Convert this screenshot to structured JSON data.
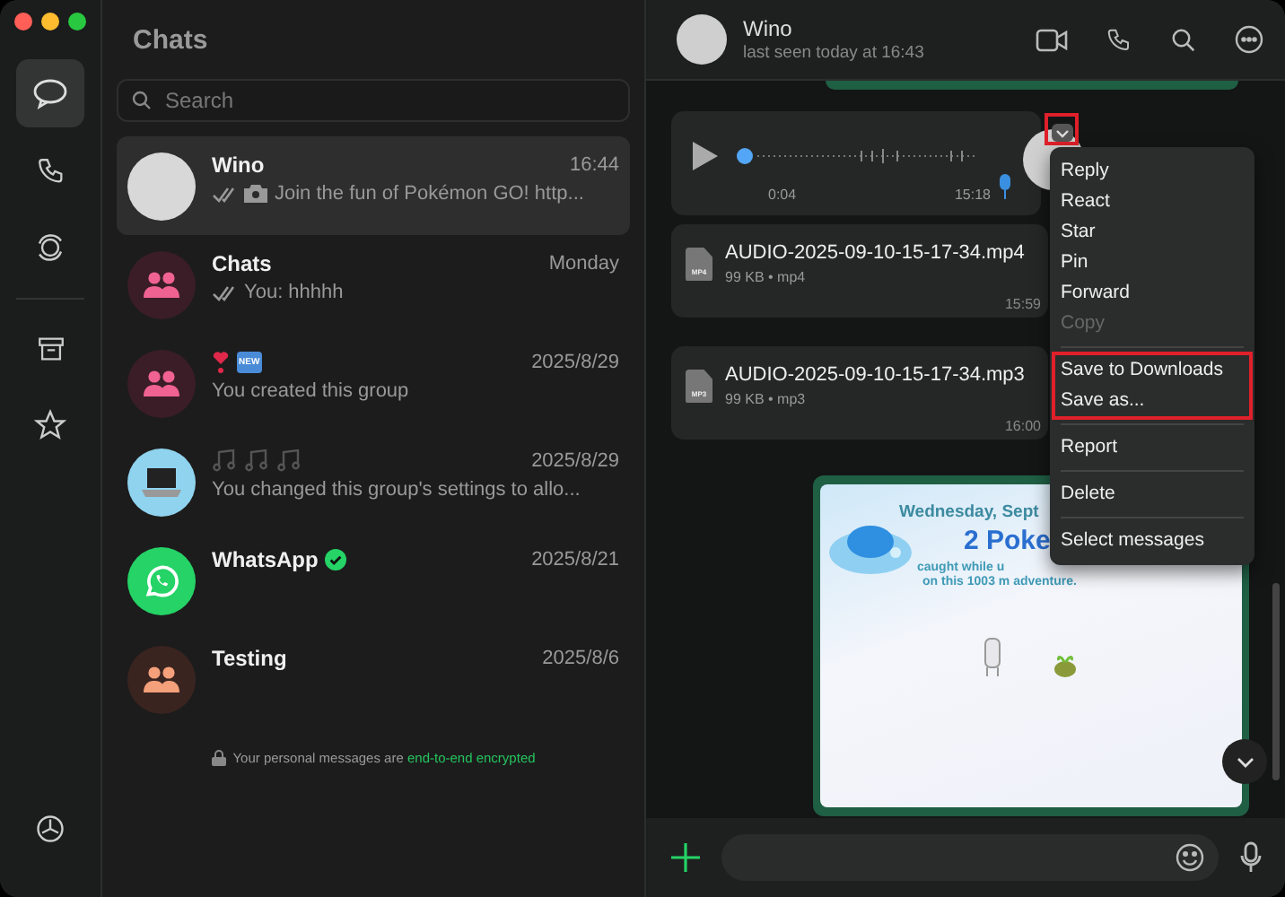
{
  "rail": {
    "top": [
      {
        "selected": true
      },
      {
        "selected": false
      },
      {
        "selected": false
      }
    ],
    "middle": [
      {
        "selected": false
      },
      {
        "selected": false
      }
    ],
    "bottom": [
      {
        "selected": false
      }
    ]
  },
  "chat_list": {
    "title": "Chats",
    "search": {
      "placeholder": "Search"
    },
    "rows": [
      {
        "name": "Wino",
        "time": "16:44",
        "preview": "Join the fun of Pokémon GO! http...",
        "read_ticks": true,
        "has_photo": true,
        "avatar": {
          "kind": "photo"
        },
        "selected": true
      },
      {
        "name": "Chats",
        "time": "Monday",
        "preview": "You: hhhhh",
        "read_ticks": true,
        "avatar": {
          "kind": "group",
          "color": "#f06292"
        },
        "selected": false
      },
      {
        "title_icons": [
          {
            "kind": "heart"
          },
          {
            "kind": "badge",
            "text": "NEW"
          }
        ],
        "time": "2025/8/29",
        "preview": "You created this group",
        "read_ticks": false,
        "avatar": {
          "kind": "group",
          "color": "#f06292"
        },
        "selected": false
      },
      {
        "title_icons": [
          {
            "kind": "notes"
          },
          {
            "kind": "notes"
          },
          {
            "kind": "notes"
          }
        ],
        "time": "2025/8/29",
        "preview": "You changed this group's settings to allo...",
        "read_ticks": false,
        "avatar": {
          "kind": "laptop"
        },
        "selected": false
      },
      {
        "name": "WhatsApp",
        "verified": true,
        "time": "2025/8/21",
        "read_ticks": false,
        "avatar": {
          "kind": "whatsapp"
        },
        "selected": false
      },
      {
        "name": "Testing",
        "time": "2025/8/6",
        "read_ticks": false,
        "avatar": {
          "kind": "group",
          "color": "#f4a07a"
        },
        "selected": false
      }
    ],
    "footer": {
      "text": "Your personal messages are ",
      "link": "end-to-end encrypted"
    }
  },
  "chat": {
    "header": {
      "name": "Wino",
      "status": "last seen today at 16:43"
    },
    "messages": [
      {
        "kind": "cut"
      },
      {
        "kind": "voice",
        "duration": "0:04",
        "time": "15:18"
      },
      {
        "kind": "file",
        "name": "AUDIO-2025-09-10-15-17-34.mp4",
        "ext": "MP4",
        "meta": "99 KB • mp4",
        "time": "15:59"
      },
      {
        "kind": "file",
        "name": "AUDIO-2025-09-10-15-17-34.mp3",
        "ext": "MP3",
        "meta": "99 KB • mp3",
        "time": "16:00"
      },
      {
        "kind": "image",
        "lines": [
          "Wednesday, Sept",
          "2 Poke",
          "caught while u",
          "on this 1003 m adventure."
        ]
      }
    ],
    "menu": {
      "groups": [
        {
          "highlighted": false,
          "items": [
            {
              "label": "Reply",
              "disabled": false
            },
            {
              "label": "React",
              "disabled": false
            },
            {
              "label": "Star",
              "disabled": false
            },
            {
              "label": "Pin",
              "disabled": false
            },
            {
              "label": "Forward",
              "disabled": false
            },
            {
              "label": "Copy",
              "disabled": true
            }
          ]
        },
        {
          "highlighted": true,
          "items": [
            {
              "label": "Save to Downloads",
              "disabled": false
            },
            {
              "label": "Save as...",
              "disabled": false
            }
          ]
        },
        {
          "highlighted": false,
          "items": [
            {
              "label": "Report",
              "disabled": false
            }
          ]
        },
        {
          "highlighted": false,
          "items": [
            {
              "label": "Delete",
              "disabled": false
            }
          ]
        },
        {
          "highlighted": false,
          "items": [
            {
              "label": "Select messages",
              "disabled": false
            }
          ]
        }
      ]
    }
  }
}
